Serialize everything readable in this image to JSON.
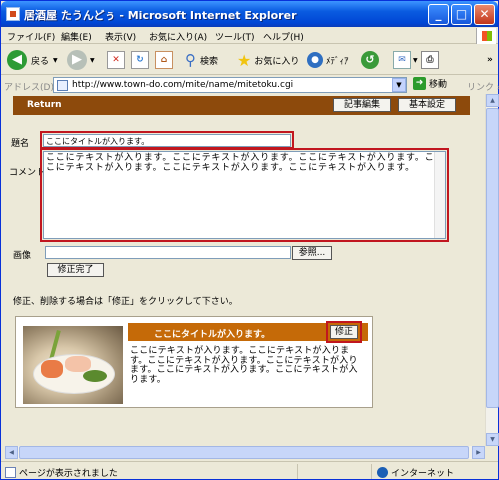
{
  "window": {
    "title": "居酒屋 たうんどぅ - Microsoft Internet Explorer",
    "min": "_",
    "max": "□",
    "close": "✕"
  },
  "menu": [
    "ファイル(F)",
    "編集(E)",
    "表示(V)",
    "お気に入り(A)",
    "ツール(T)",
    "ヘルプ(H)"
  ],
  "toolbar": {
    "back": "戻る",
    "search": "検索",
    "favorites": "お気に入り",
    "media": "ﾒﾃﾞｨｱ"
  },
  "address": {
    "label": "アドレス(D)",
    "url": "http://www.town-do.com/mite/name/mitetoku.cgi",
    "go": "移動",
    "links": "リンク"
  },
  "page": {
    "return_label": "Return",
    "edit_btn": "記事編集",
    "settings_btn": "基本設定",
    "title_label": "題名",
    "title_value": "ここにタイトルが入ります。",
    "comment_label": "コメント",
    "comment_value": "ここにテキストが入ります。ここにテキストが入ります。ここにテキストが入ります。ここにテキストが入ります。ここにテキストが入ります。ここにテキストが入ります。",
    "image_label": "画像",
    "browse_btn": "参照...",
    "done_btn": "修正完了",
    "instruction": "修正、削除する場合は「修正」をクリックして下さい。",
    "card_title": "ここにタイトルが入ります。",
    "card_edit_btn": "修正",
    "card_text": "ここにテキストが入ります。ここにテキストが入ります。ここにテキストが入ります。ここにテキストが入ります。ここにテキストが入ります。ここにテキストが入ります。"
  },
  "status": {
    "text": "ページが表示されました",
    "zone": "インターネット"
  },
  "colors": {
    "header": "#8d4a0c",
    "card_bar": "#c56a08",
    "highlight": "#c1161f"
  }
}
